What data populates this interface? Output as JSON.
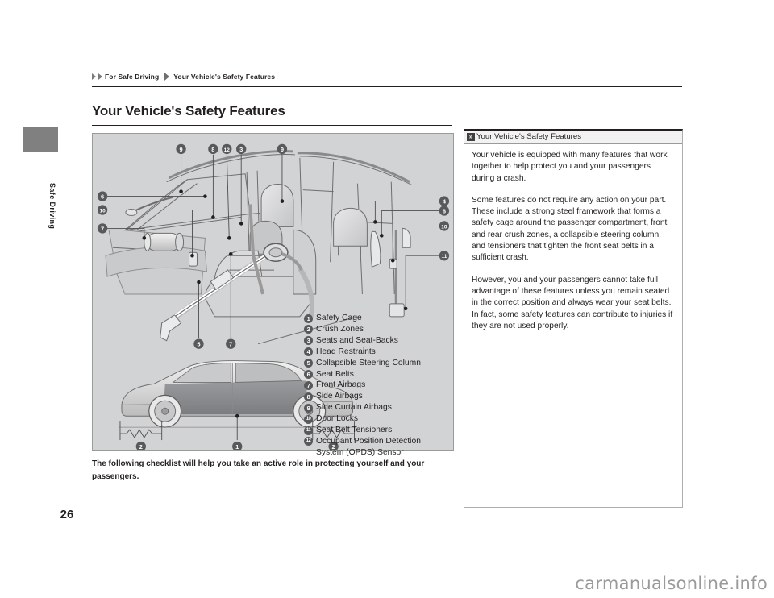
{
  "document": {
    "page_number": "26",
    "side_tab_label": "Safe Driving",
    "watermark": "carmanualsonline.info"
  },
  "breadcrumb": {
    "level1": "For Safe Driving",
    "level2": "Your Vehicle's Safety Features",
    "arrow_icon": "triangle-right"
  },
  "page_title": "Your Vehicle's Safety Features",
  "figure": {
    "alt": "Cutaway illustration of vehicle interior showing safety features and side view of sedan showing crush zones",
    "callouts_interior": [
      "9",
      "8",
      "12",
      "3",
      "9",
      "6",
      "10",
      "7",
      "4",
      "8",
      "10",
      "11",
      "5",
      "7"
    ],
    "callouts_sideview": [
      "2",
      "1",
      "2"
    ],
    "legend": [
      {
        "num": "1",
        "label": "Safety Cage"
      },
      {
        "num": "2",
        "label": "Crush Zones"
      },
      {
        "num": "3",
        "label": "Seats and Seat-Backs"
      },
      {
        "num": "4",
        "label": "Head Restraints"
      },
      {
        "num": "5",
        "label": "Collapsible Steering Column"
      },
      {
        "num": "6",
        "label": "Seat Belts"
      },
      {
        "num": "7",
        "label": "Front Airbags"
      },
      {
        "num": "8",
        "label": "Side Airbags"
      },
      {
        "num": "9",
        "label": "Side Curtain Airbags"
      },
      {
        "num": "10",
        "label": "Door Locks"
      },
      {
        "num": "11",
        "label": "Seat Belt Tensioners"
      },
      {
        "num": "12",
        "label": "Occupant Position Detection",
        "label2": "System (OPDS) Sensor"
      }
    ]
  },
  "caption": "The following checklist will help you take an active role in protecting yourself and your passengers.",
  "infobox": {
    "icon": "double-chevron-right-icon",
    "icon_glyph": "»",
    "title": "Your Vehicle's Safety Features",
    "paragraphs": [
      "Your vehicle is equipped with many features that work together to help protect you and your passengers during a crash.",
      "Some features do not require any action on your part. These include a strong steel framework that forms a safety cage around the passenger compartment, front and rear crush zones, a collapsible steering column, and tensioners that tighten the front seat belts in a sufficient crash.",
      "However, you and your passengers cannot take full advantage of these features unless you remain seated in the correct position and always wear your seat belts. In fact, some safety features can contribute to injuries if they are not used properly."
    ]
  },
  "colors": {
    "ink": "#231f20",
    "figure_bg": "#d2d3d5",
    "tab_gray": "#808080",
    "badge": "#58595b"
  }
}
